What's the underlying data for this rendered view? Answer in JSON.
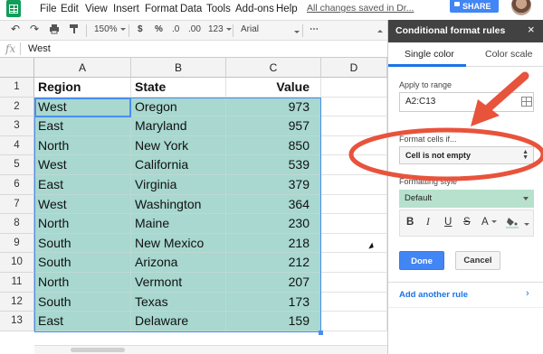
{
  "menu": {
    "items": [
      "File",
      "Edit",
      "View",
      "Insert",
      "Format",
      "Data",
      "Tools",
      "Add-ons",
      "Help"
    ],
    "saved_status": "All changes saved in Dr...",
    "share_label": "SHARE"
  },
  "toolbar": {
    "zoom": "150%",
    "currency": "$",
    "percent": "%",
    "decrease_decimals": ".0",
    "increase_decimals": ".00",
    "more_formats": "123",
    "font": "Arial",
    "more": "⋯"
  },
  "formula_bar": {
    "fx_label": "fx",
    "value": "West"
  },
  "grid": {
    "columns": [
      "A",
      "B",
      "C",
      "D"
    ],
    "rows": [
      {
        "num": "1",
        "cells": [
          "Region",
          "State",
          "Value"
        ]
      },
      {
        "num": "2",
        "cells": [
          "West",
          "Oregon",
          "973"
        ]
      },
      {
        "num": "3",
        "cells": [
          "East",
          "Maryland",
          "957"
        ]
      },
      {
        "num": "4",
        "cells": [
          "North",
          "New York",
          "850"
        ]
      },
      {
        "num": "5",
        "cells": [
          "West",
          "California",
          "539"
        ]
      },
      {
        "num": "6",
        "cells": [
          "East",
          "Virginia",
          "379"
        ]
      },
      {
        "num": "7",
        "cells": [
          "West",
          "Washington",
          "364"
        ]
      },
      {
        "num": "8",
        "cells": [
          "North",
          "Maine",
          "230"
        ]
      },
      {
        "num": "9",
        "cells": [
          "South",
          "New Mexico",
          "218"
        ]
      },
      {
        "num": "10",
        "cells": [
          "South",
          "Arizona",
          "212"
        ]
      },
      {
        "num": "11",
        "cells": [
          "North",
          "Vermont",
          "207"
        ]
      },
      {
        "num": "12",
        "cells": [
          "South",
          "Texas",
          "173"
        ]
      },
      {
        "num": "13",
        "cells": [
          "East",
          "Delaware",
          "159"
        ]
      }
    ],
    "highlight_color": "#a8d8d0",
    "selection_color": "#4a8df0"
  },
  "panel": {
    "title": "Conditional format rules",
    "close": "×",
    "tabs": [
      "Single color",
      "Color scale"
    ],
    "active_tab": "Single color",
    "apply_label": "Apply to range",
    "range_value": "A2:C13",
    "format_cells_label": "Format cells if...",
    "condition": "Cell is not empty",
    "formatting_style_label": "Formatting style",
    "style_value": "Default",
    "style_color": "#b7e1cd",
    "fmt_buttons": [
      "B",
      "I",
      "U",
      "S",
      "A"
    ],
    "done_label": "Done",
    "cancel_label": "Cancel",
    "add_rule_label": "Add another rule",
    "accent": "#1a73e8"
  },
  "annotation": {
    "color": "#e8533c"
  }
}
